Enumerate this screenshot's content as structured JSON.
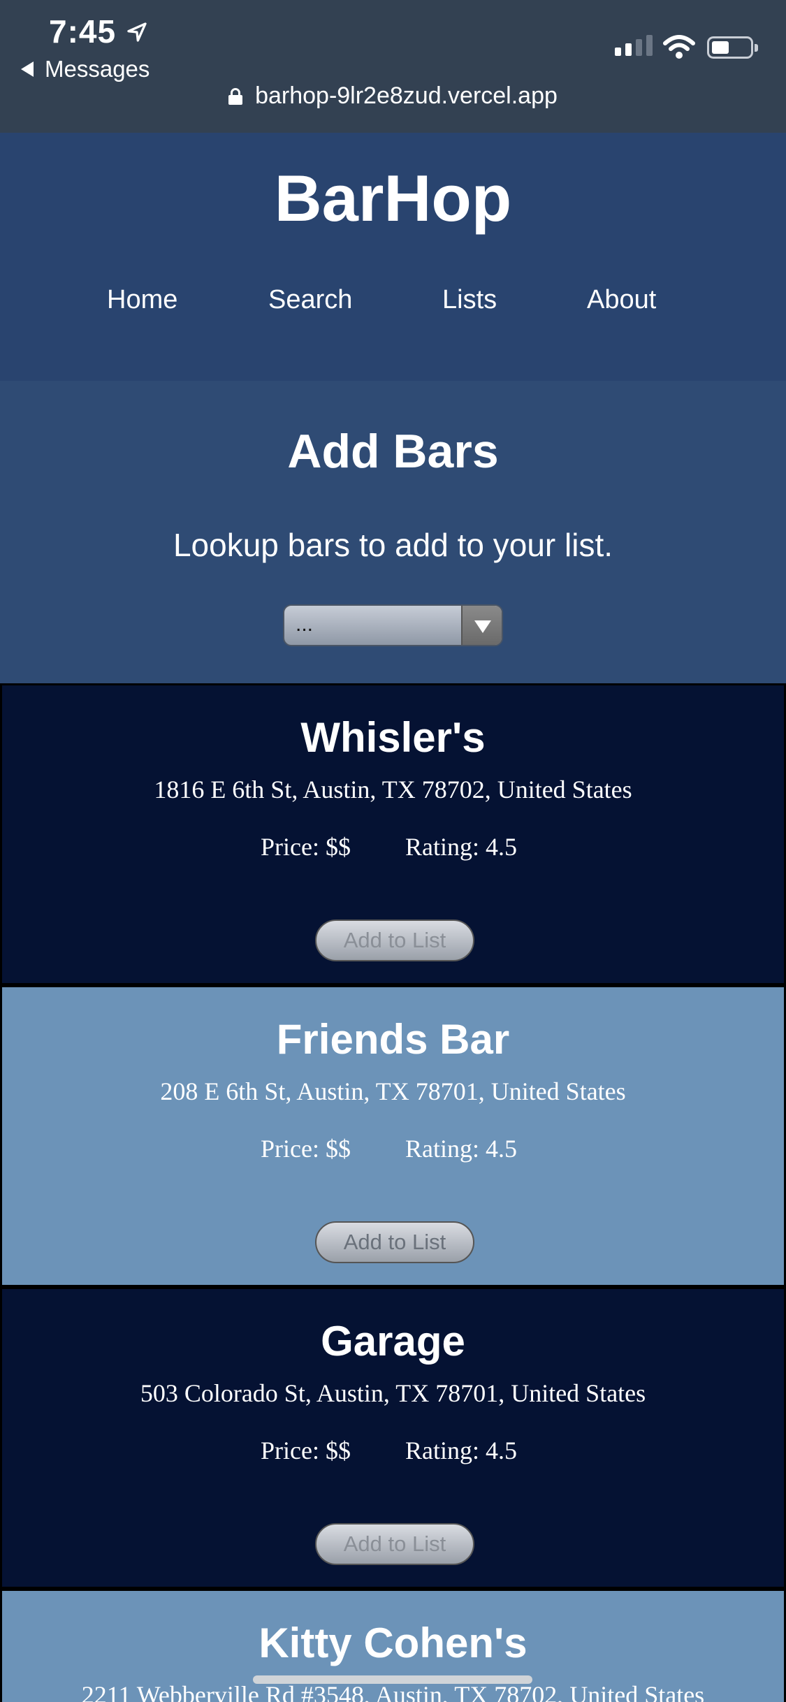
{
  "status_bar": {
    "time": "7:45",
    "back_label": "Messages",
    "url": "barhop-9lr2e8zud.vercel.app"
  },
  "header": {
    "brand": "BarHop",
    "nav": [
      "Home",
      "Search",
      "Lists",
      "About"
    ]
  },
  "add_section": {
    "title": "Add Bars",
    "subtitle": "Lookup bars to add to your list.",
    "select_value": "..."
  },
  "bars": [
    {
      "name": "Whisler's",
      "address": "1816 E 6th St, Austin, TX 78702, United States",
      "price": "Price: $$",
      "rating": "Rating: 4.5",
      "button": "Add to List"
    },
    {
      "name": "Friends Bar",
      "address": "208 E 6th St, Austin, TX 78701, United States",
      "price": "Price: $$",
      "rating": "Rating: 4.5",
      "button": "Add to List"
    },
    {
      "name": "Garage",
      "address": "503 Colorado St, Austin, TX 78701, United States",
      "price": "Price: $$",
      "rating": "Rating: 4.5",
      "button": "Add to List"
    },
    {
      "name": "Kitty Cohen's",
      "address": "2211 Webberville Rd #3548, Austin, TX 78702, United States"
    }
  ],
  "colors": {
    "status_bg": "#334152",
    "header_bg": "#29446f",
    "section_bg": "#2f4b74",
    "card_dark": "#051233",
    "card_light": "#6c93b8"
  },
  "icons": [
    "location-arrow-icon",
    "back-arrow-icon",
    "signal-icon",
    "wifi-icon",
    "battery-icon",
    "lock-icon",
    "dropdown-arrow-icon"
  ]
}
